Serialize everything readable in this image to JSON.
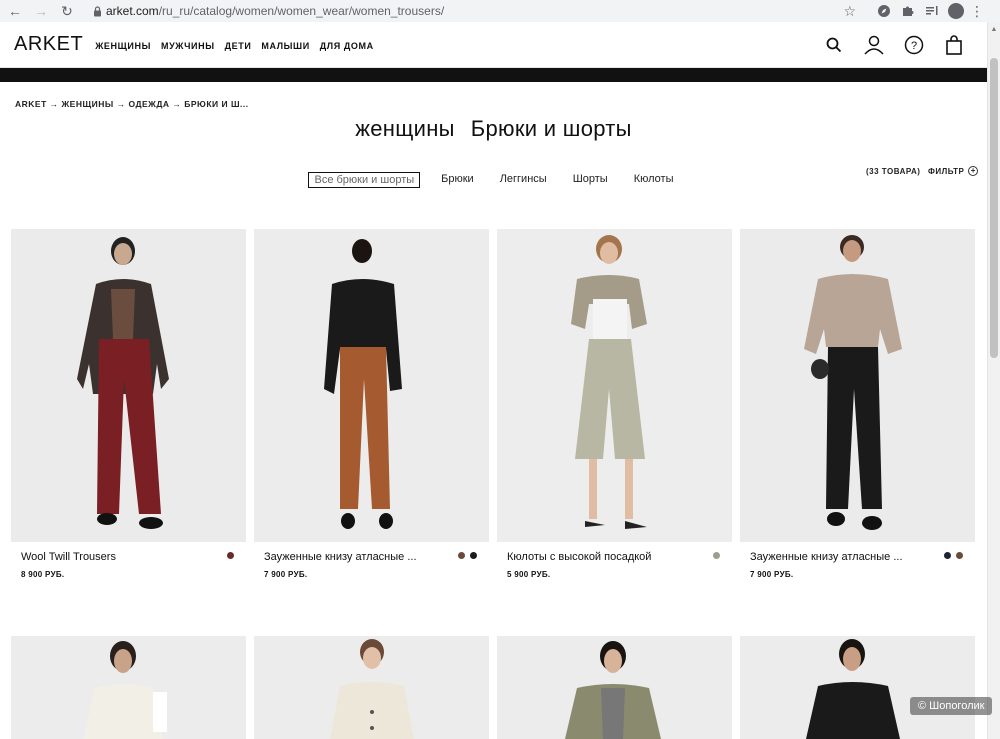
{
  "browser": {
    "url_domain": "arket.com",
    "url_path": "/ru_ru/catalog/women/women_wear/women_trousers/"
  },
  "header": {
    "logo": "ARKET",
    "nav": [
      "ЖЕНЩИНЫ",
      "МУЖЧИНЫ",
      "ДЕТИ",
      "МАЛЫШИ",
      "ДЛЯ ДОМА"
    ],
    "icons": [
      "search-icon",
      "account-icon",
      "help-icon",
      "bag-icon"
    ]
  },
  "breadcrumb": "ARKET → ЖЕНЩИНЫ → ОДЕЖДА → БРЮКИ И Ш...",
  "title": {
    "category": "женщины",
    "subcategory": "Брюки и шорты"
  },
  "filters": [
    "Все брюки и шорты",
    "Брюки",
    "Леггинсы",
    "Шорты",
    "Кюлоты"
  ],
  "count": "(33 ТОВАРА)",
  "filter_label": "ФИЛЬТР",
  "products": [
    {
      "name": "Wool Twill Trousers",
      "price": "8 900 РУБ.",
      "swatches": [
        "#6b2a2a"
      ]
    },
    {
      "name": "Зауженные книзу атласные ...",
      "price": "7 900 РУБ.",
      "swatches": [
        "#6b4a3a",
        "#1c1c1c"
      ]
    },
    {
      "name": "Кюлоты с высокой посадкой",
      "price": "5 900 РУБ.",
      "swatches": [
        "#9c9f8e"
      ]
    },
    {
      "name": "Зауженные книзу атласные ...",
      "price": "7 900 РУБ.",
      "swatches": [
        "#1f2230",
        "#6b4a3a"
      ]
    }
  ],
  "watermark": "© Шопоголик",
  "colors": {
    "accent": "#111111",
    "trouser_red": "#7a1f24",
    "trouser_rust": "#a65a30",
    "culotte_sage": "#b8b7a4",
    "trouser_black": "#1a1a1a"
  }
}
